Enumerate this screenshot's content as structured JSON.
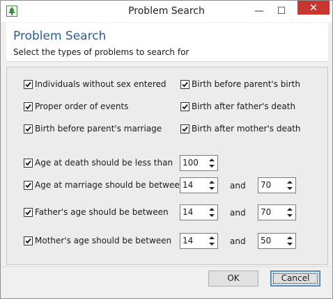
{
  "window": {
    "title": "Problem Search",
    "controls": {
      "minimize": "—",
      "maximize": "☐",
      "close": "✕"
    }
  },
  "header": {
    "title": "Problem Search",
    "subtitle": "Select the types of problems to search for"
  },
  "options": {
    "no_sex": {
      "label": "Individuals without sex entered",
      "checked": true
    },
    "order_events": {
      "label": "Proper order of events",
      "checked": true
    },
    "birth_before_marriage": {
      "label": "Birth before parent's marriage",
      "checked": true
    },
    "birth_before_parent_birth": {
      "label": "Birth before parent's birth",
      "checked": true
    },
    "birth_after_father_death": {
      "label": "Birth after father's death",
      "checked": true
    },
    "birth_after_mother_death": {
      "label": "Birth after mother's death",
      "checked": true
    },
    "age_at_death": {
      "label": "Age at death should be less than",
      "checked": true,
      "value": "100"
    },
    "age_at_marriage": {
      "label": "Age at marriage should be between",
      "checked": true,
      "min": "14",
      "max": "70"
    },
    "father_age": {
      "label": "Father's age should be between",
      "checked": true,
      "min": "14",
      "max": "70"
    },
    "mother_age": {
      "label": "Mother's age should be between",
      "checked": true,
      "min": "14",
      "max": "50"
    },
    "and_label": "and"
  },
  "buttons": {
    "ok": "OK",
    "cancel": "Cancel"
  },
  "colors": {
    "header_title": "#2c5d95",
    "close_button": "#c7372f",
    "focus_border": "#3c7fb1"
  },
  "icons": {
    "app": "tree-icon",
    "check": "check-icon",
    "spin": "spin-arrows-icon"
  }
}
